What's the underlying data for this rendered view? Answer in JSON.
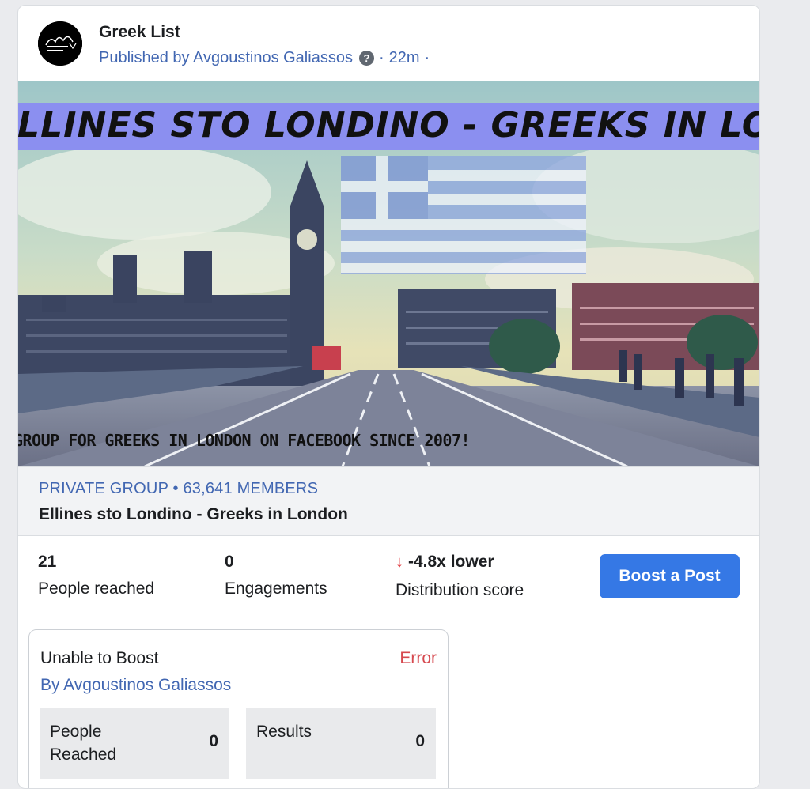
{
  "post": {
    "page_name": "Greek List",
    "published_by": "Published by Avgoustinos Galiassos",
    "time": "22m",
    "separator": "·"
  },
  "banner": {
    "title": "ELLINES STO LONDINO - GREEKS IN LONDON",
    "caption": "GROUP FOR GREEKS IN LONDON ON FACEBOOK SINCE 2007!"
  },
  "link": {
    "subtitle": "PRIVATE GROUP • 63,641 MEMBERS",
    "title": "Ellines sto Londino - Greeks in London"
  },
  "stats": {
    "reached_value": "21",
    "reached_label": "People reached",
    "engagements_value": "0",
    "engagements_label": "Engagements",
    "distribution_value": "-4.8x lower",
    "distribution_label": "Distribution score",
    "distribution_arrow": "↓"
  },
  "boost_button": "Boost a Post",
  "boost_status": {
    "title": "Unable to Boost",
    "status": "Error",
    "by": "By Avgoustinos Galiassos",
    "people_reached_label": "People Reached",
    "people_reached_value": "0",
    "results_label": "Results",
    "results_value": "0"
  },
  "colors": {
    "link_blue": "#4267b2",
    "button_blue": "#3578e5",
    "error_red": "#d6494f"
  }
}
